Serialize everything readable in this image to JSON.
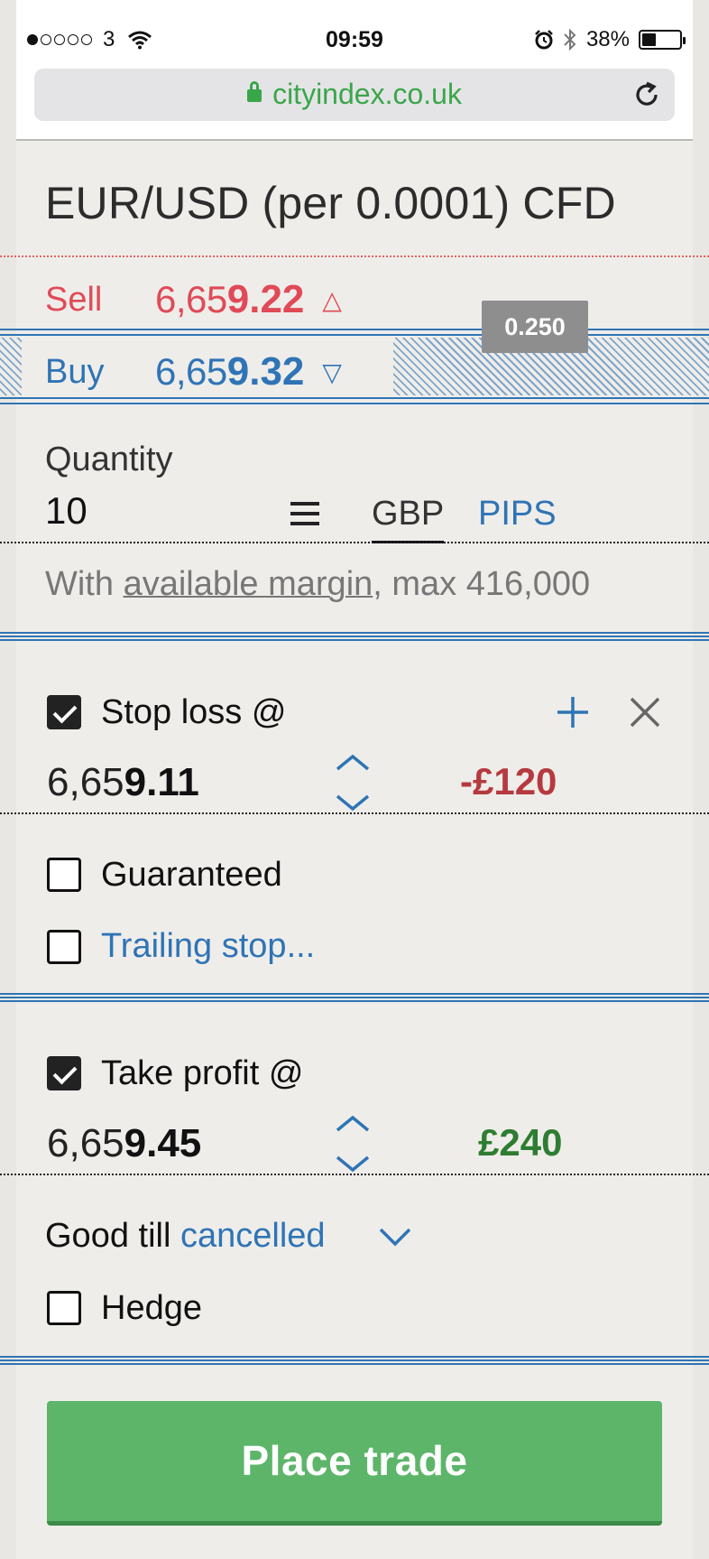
{
  "status_bar": {
    "carrier": "3",
    "time": "09:59",
    "battery_percent": "38%",
    "battery_level": 0.38,
    "icons": [
      "signal-dots-icon",
      "wifi-icon",
      "alarm-icon",
      "bluetooth-icon",
      "battery-icon"
    ]
  },
  "browser": {
    "url": "cityindex.co.uk",
    "url_color": "#3aa64a"
  },
  "instrument": {
    "title": "EUR/USD (per 0.0001) CFD"
  },
  "sell": {
    "label": "Sell",
    "price_prefix": "6,65",
    "price_main": "9.22",
    "direction": "△",
    "color": "#e04a57"
  },
  "buy": {
    "label": "Buy",
    "price_prefix": "6,65",
    "price_main": "9.32",
    "direction": "▽",
    "color": "#2f74b5"
  },
  "spread": "0.250",
  "quantity": {
    "label": "Quantity",
    "value": "10",
    "unit_selected": "GBP",
    "unit_other": "PIPS",
    "margin_prefix": "With ",
    "margin_link": "available margin",
    "margin_suffix": ", max 416,000"
  },
  "stop_loss": {
    "checked": true,
    "label": "Stop loss @",
    "price_prefix": "6,65",
    "price_main": "9.11",
    "pnl": "-£120"
  },
  "guaranteed": {
    "checked": false,
    "label": "Guaranteed"
  },
  "trailing_stop": {
    "checked": false,
    "label": "Trailing stop..."
  },
  "take_profit": {
    "checked": true,
    "label": "Take profit @",
    "price_prefix": "6,65",
    "price_main": "9.45",
    "pnl": "£240"
  },
  "good_till": {
    "label": "Good till ",
    "value": "cancelled"
  },
  "hedge": {
    "checked": false,
    "label": "Hedge"
  },
  "place_trade": {
    "label": "Place trade",
    "color": "#5db56a"
  }
}
